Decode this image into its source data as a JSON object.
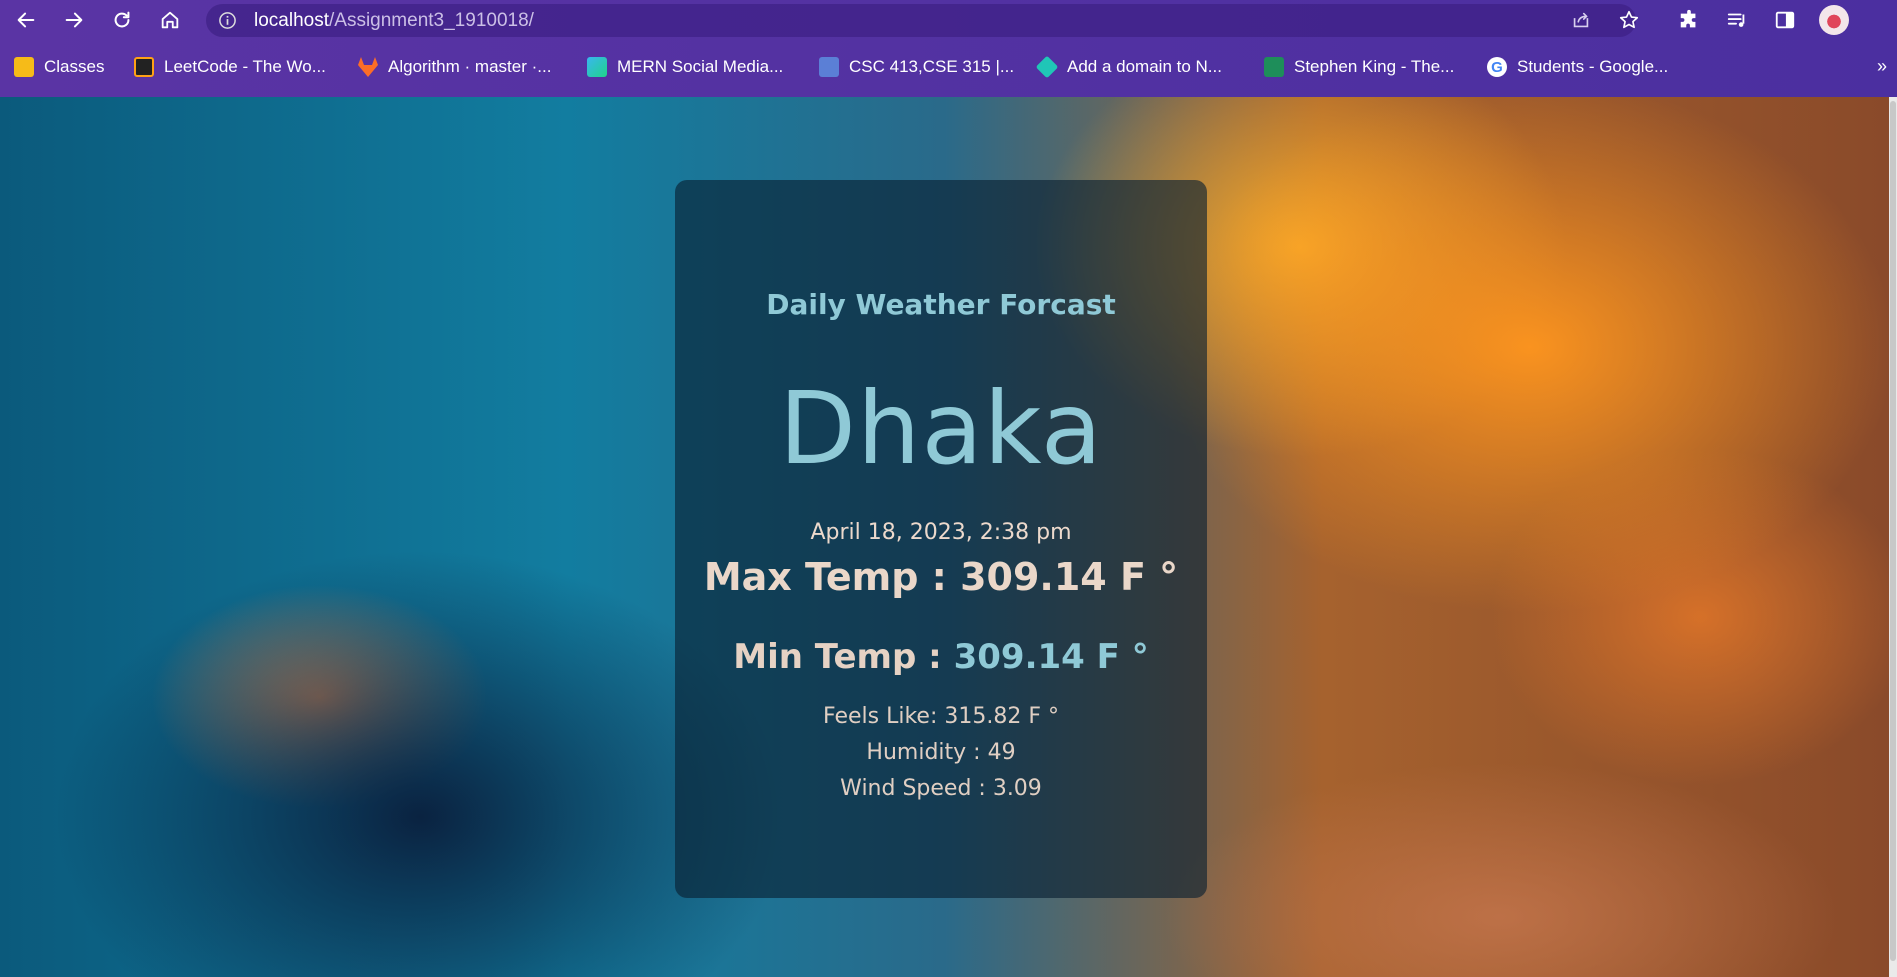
{
  "browser": {
    "url_host": "localhost",
    "url_path": "/Assignment3_1910018/",
    "bookmarks": [
      {
        "label": "Classes",
        "icon": "google-classroom-icon",
        "color": "#f6bb18"
      },
      {
        "label": "LeetCode - The Wo...",
        "icon": "leetcode-icon",
        "color": "#ffa116"
      },
      {
        "label": "Algorithm · master ·...",
        "icon": "gitlab-icon",
        "color": "#fc6d26"
      },
      {
        "label": "MERN Social Media...",
        "icon": "mern-icon",
        "color": "#3ab6f0"
      },
      {
        "label": "CSC 413,CSE 315 |...",
        "icon": "p-icon",
        "color": "#5b7fd6"
      },
      {
        "label": "Add a domain to N...",
        "icon": "netlify-icon",
        "color": "#20c6b7"
      },
      {
        "label": "Stephen King - The...",
        "icon": "video-icon",
        "color": "#1e8e5a"
      },
      {
        "label": "Students - Google...",
        "icon": "google-icon",
        "color": "#4285f4"
      }
    ],
    "more_label": "»"
  },
  "weather": {
    "heading": "Daily Weather Forcast",
    "city": "Dhaka",
    "datetime": "April 18, 2023, 2:38 pm",
    "max_label": "Max Temp : ",
    "max_value": "309.14 F °",
    "min_label": "Min Temp : ",
    "min_value": "309.14 F °",
    "feels_like": "Feels Like: 315.82 F °",
    "humidity": "Humidity : 49",
    "wind_speed": "Wind Speed : 3.09"
  }
}
